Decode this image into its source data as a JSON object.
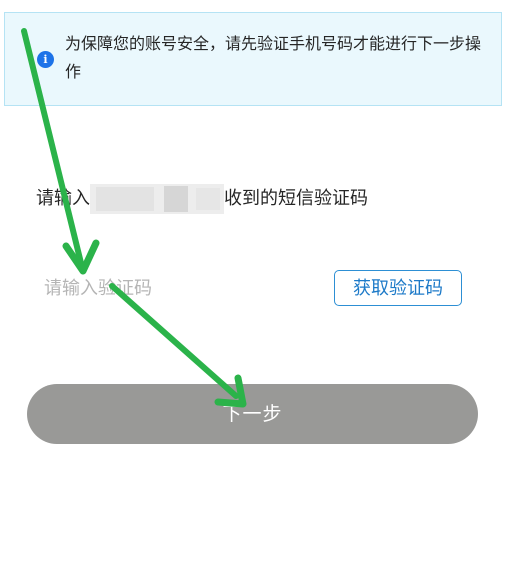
{
  "notice": {
    "icon": "info-icon",
    "text": "为保障您的账号安全，请先验证手机号码才能进行下一步操作"
  },
  "verification": {
    "prompt_prefix": "请输入",
    "prompt_suffix": "收到的短信验证码",
    "code_placeholder": "请输入验证码",
    "get_code_label": "获取验证码"
  },
  "next_button": {
    "label": "下一步"
  },
  "annotation": {
    "arrow_color": "#2bb34a"
  },
  "colors": {
    "notice_bg": "#eaf8fd",
    "info_blue": "#1d73e8",
    "link_blue": "#1d7ac8",
    "button_gray": "#999997"
  }
}
